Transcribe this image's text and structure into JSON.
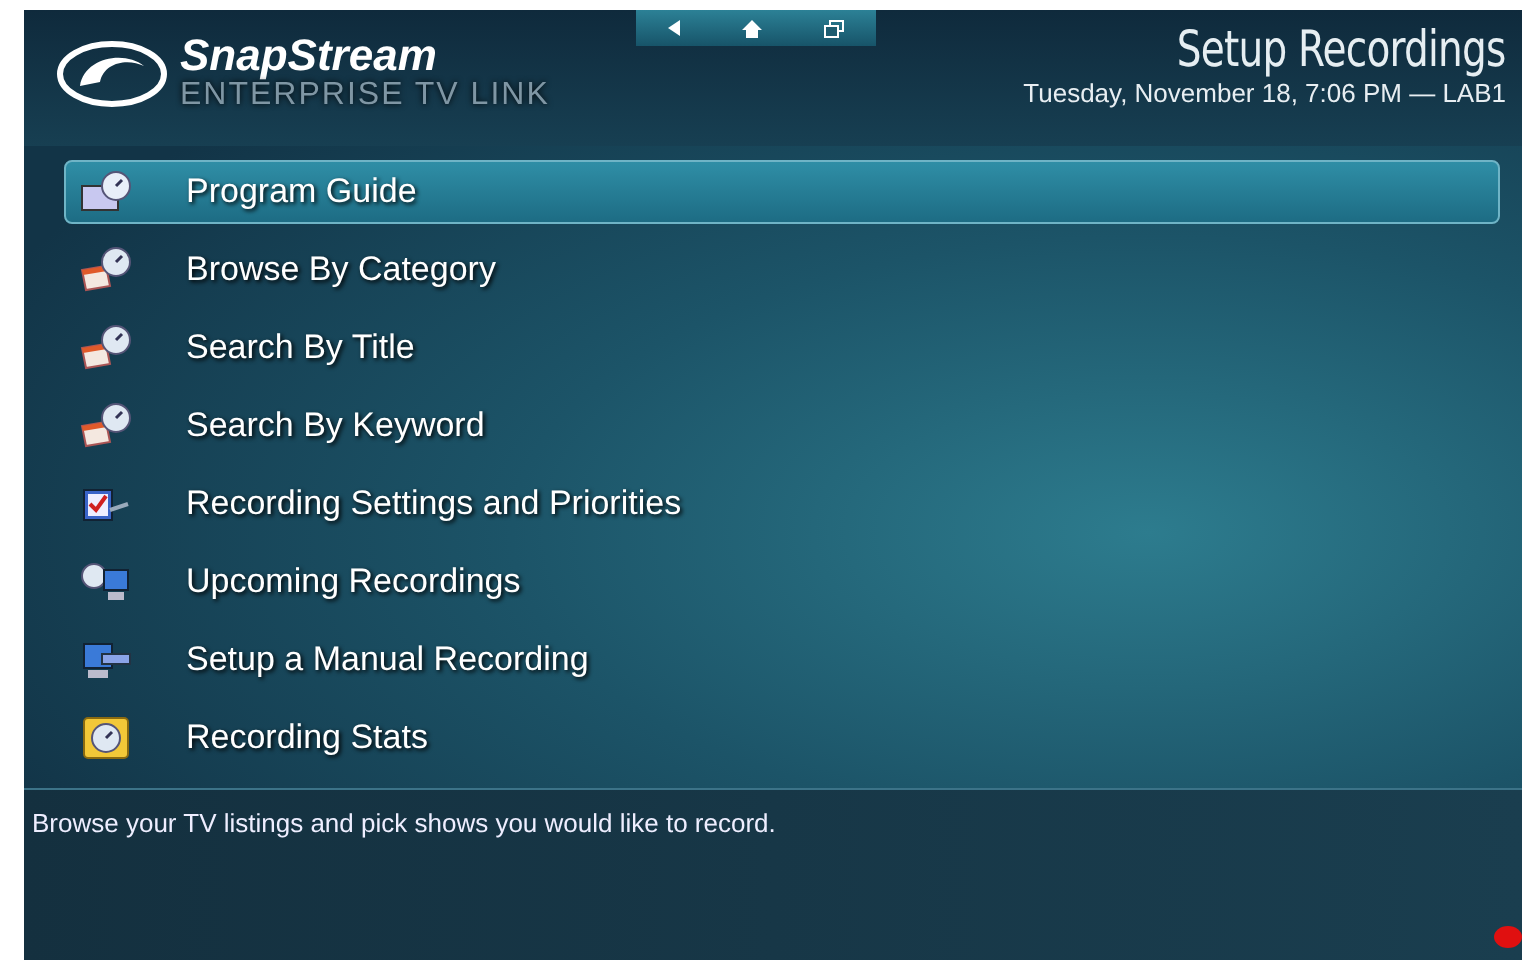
{
  "brand": {
    "name": "SnapStream",
    "tagline": "ENTERPRISE TV LINK"
  },
  "page_title": "Setup Recordings",
  "status_line": "Tuesday, November 18, 7:06 PM — LAB1",
  "menu": [
    {
      "label": "Program Guide",
      "kind": "guide",
      "selected": true
    },
    {
      "label": "Browse By Category",
      "kind": "calendar",
      "selected": false
    },
    {
      "label": "Search By Title",
      "kind": "calendar",
      "selected": false
    },
    {
      "label": "Search By Keyword",
      "kind": "calendar",
      "selected": false
    },
    {
      "label": "Recording Settings and Priorities",
      "kind": "checklist",
      "selected": false
    },
    {
      "label": "Upcoming Recordings",
      "kind": "schedule",
      "selected": false
    },
    {
      "label": "Setup a Manual Recording",
      "kind": "manual",
      "selected": false
    },
    {
      "label": "Recording Stats",
      "kind": "stats",
      "selected": false
    }
  ],
  "description": "Browse your TV listings and pick shows you would like to record."
}
